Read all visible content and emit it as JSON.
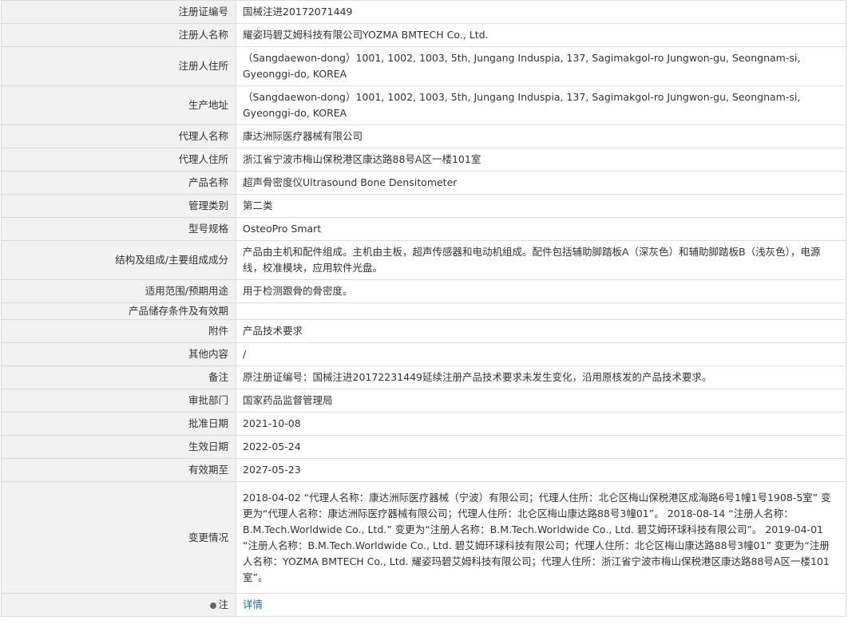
{
  "rows": [
    {
      "label": "注册证编号",
      "value": "国械注进20172071449"
    },
    {
      "label": "注册人名称",
      "value": "耀姿玛碧艾姆科技有限公司YOZMA BMTECH Co., Ltd."
    },
    {
      "label": "注册人住所",
      "value": "（Sangdaewon-dong）1001, 1002, 1003, 5th, Jungang Induspia, 137, Sagimakgol-ro Jungwon-gu, Seongnam-si, Gyeonggi-do, KOREA"
    },
    {
      "label": "生产地址",
      "value": "（Sangdaewon-dong）1001, 1002, 1003, 5th, Jungang Induspia, 137, Sagimakgol-ro Jungwon-gu, Seongnam-si, Gyeonggi-do, KOREA"
    },
    {
      "label": "代理人名称",
      "value": "康达洲际医疗器械有限公司"
    },
    {
      "label": "代理人住所",
      "value": "浙江省宁波市梅山保税港区康达路88号A区一楼101室"
    },
    {
      "label": "产品名称",
      "value": "超声骨密度仪Ultrasound Bone Densitometer"
    },
    {
      "label": "管理类别",
      "value": "第二类"
    },
    {
      "label": "型号规格",
      "value": "OsteoPro Smart"
    },
    {
      "label": "结构及组成/主要组成成分",
      "value": "产品由主机和配件组成。主机由主板，超声传感器和电动机组成。配件包括辅助脚踏板A（深灰色）和辅助脚踏板B（浅灰色），电源线，校准模块，应用软件光盘。"
    },
    {
      "label": "适用范围/预期用途",
      "value": "用于检测跟骨的骨密度。"
    },
    {
      "label": "产品储存条件及有效期",
      "value": ""
    },
    {
      "label": "附件",
      "value": "产品技术要求"
    },
    {
      "label": "其他内容",
      "value": "/"
    },
    {
      "label": "备注",
      "value": "原注册证编号：国械注进20172231449延续注册产品技术要求未发生变化，沿用原核发的产品技术要求。"
    },
    {
      "label": "审批部门",
      "value": "国家药品监督管理局"
    },
    {
      "label": "批准日期",
      "value": "2021-10-08"
    },
    {
      "label": "生效日期",
      "value": "2022-05-24"
    },
    {
      "label": "有效期至",
      "value": "2027-05-23"
    },
    {
      "label": "变更情况",
      "value": "2018-04-02 “代理人名称：康达洲际医疗器械（宁波）有限公司；代理人住所：北仑区梅山保税港区成海路6号1幢1号1908-5室” 变更为“代理人名称：康达洲际医疗器械有限公司；代理人住所：北仑区梅山康达路88号3幢01”。 2018-08-14 “注册人名称：B.M.Tech.Worldwide Co., Ltd.” 变更为“注册人名称：B.M.Tech.Worldwide Co., Ltd. 碧艾姆环球科技有限公司”。 2019-04-01 “注册人名称：B.M.Tech.Worldwide Co., Ltd. 碧艾姆环球科技有限公司；代理人住所：北仑区梅山康达路88号3幢01” 变更为“注册人名称：YOZMA BMTECH Co., Ltd. 耀姿玛碧艾姆科技有限公司；代理人住所：浙江省宁波市梅山保税港区康达路88号A区一楼101室”。"
    }
  ],
  "note": {
    "label": "注",
    "link_text": "详情",
    "icon": "lightbulb-icon"
  }
}
